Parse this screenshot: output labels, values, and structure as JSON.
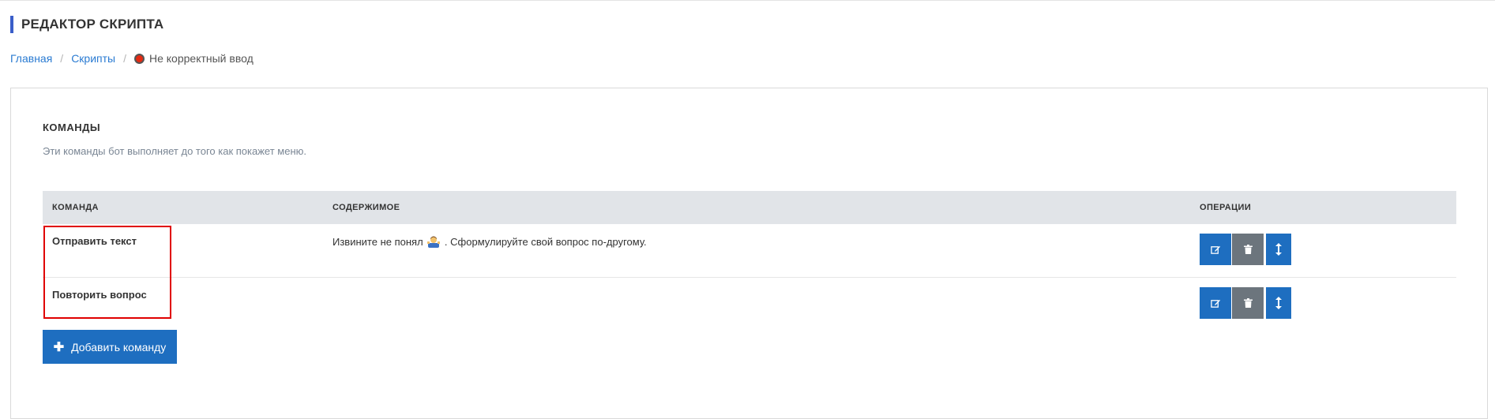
{
  "header": {
    "title": "РЕДАКТОР СКРИПТА"
  },
  "breadcrumb": {
    "items": [
      {
        "label": "Главная"
      },
      {
        "label": "Скрипты"
      }
    ],
    "separator": "/",
    "current": "Не корректный ввод",
    "status_color": "#e52a12"
  },
  "section": {
    "title": "КОМАНДЫ",
    "description": "Эти команды бот выполняет до того как покажет меню."
  },
  "table": {
    "headers": {
      "command": "КОМАНДА",
      "content": "СОДЕРЖИМОЕ",
      "operations": "ОПЕРАЦИИ"
    },
    "rows": [
      {
        "command": "Отправить текст",
        "content_before": "Извините не понял",
        "content_emoji": "person-shrugging-emoji",
        "content_after": ". Сформулируйте свой вопрос по-другому."
      },
      {
        "command": "Повторить вопрос",
        "content_before": "",
        "content_emoji": "",
        "content_after": ""
      }
    ],
    "operation_icons": [
      "edit-icon",
      "trash-icon",
      "move-vertical-icon"
    ]
  },
  "actions": {
    "add_command_label": "Добавить команду"
  },
  "colors": {
    "accent": "#1e6ec0",
    "title_bar": "#3a5ec9",
    "highlight": "#e00000",
    "delete": "#6c757d"
  }
}
